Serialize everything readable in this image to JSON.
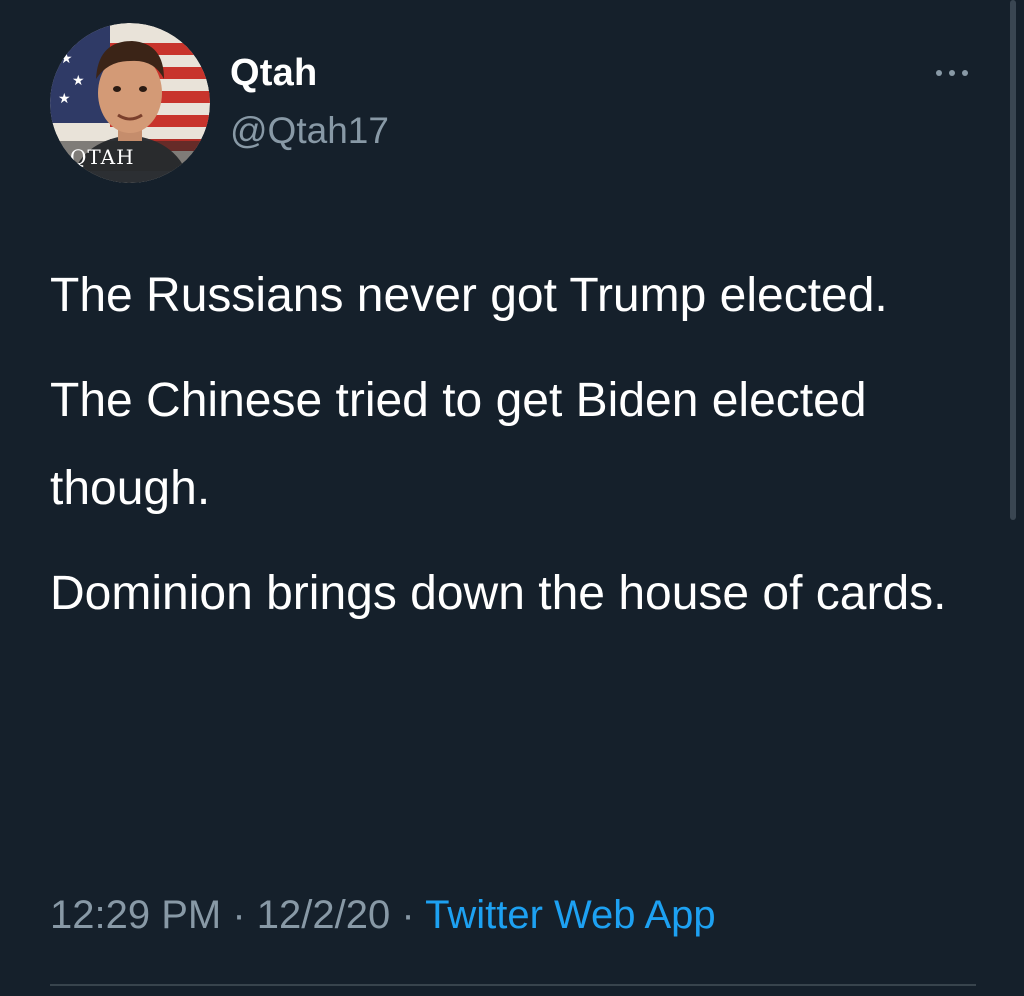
{
  "user": {
    "display_name": "Qtah",
    "handle": "@Qtah17",
    "avatar_badge_text": "QTAH"
  },
  "tweet": {
    "paragraphs": [
      "The Russians never got Trump elected.",
      "The Chinese tried to get Biden elected though.",
      "Dominion brings down the house of cards."
    ],
    "time": "12:29 PM",
    "separator": "·",
    "date": "12/2/20",
    "source": "Twitter Web App"
  },
  "colors": {
    "background": "#15202b",
    "primary_text": "#ffffff",
    "secondary_text": "#8899a6",
    "link": "#1da1f2"
  },
  "icons": {
    "more": "more-horizontal-icon"
  }
}
